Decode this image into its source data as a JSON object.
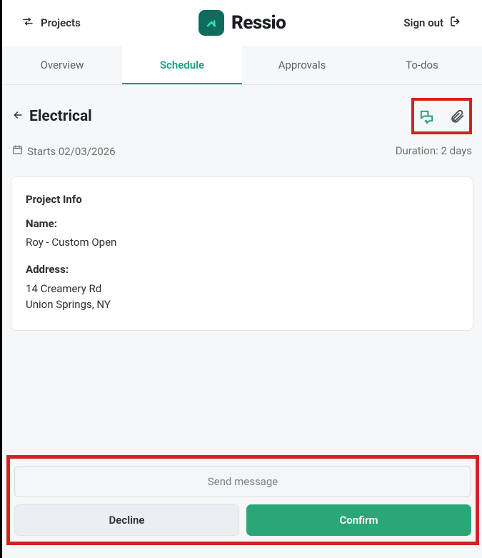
{
  "topbar": {
    "projects_label": "Projects",
    "brand_name": "Ressio",
    "signout_label": "Sign out"
  },
  "tabs": [
    {
      "label": "Overview",
      "active": false
    },
    {
      "label": "Schedule",
      "active": true
    },
    {
      "label": "Approvals",
      "active": false
    },
    {
      "label": "To-dos",
      "active": false
    }
  ],
  "page": {
    "title": "Electrical",
    "starts_text": "Starts 02/03/2026",
    "duration_text": "Duration: 2 days"
  },
  "project_info": {
    "heading": "Project Info",
    "name_label": "Name:",
    "name_value": "Roy - Custom Open",
    "address_label": "Address:",
    "address_line1": "14 Creamery Rd",
    "address_line2": "Union Springs, NY"
  },
  "footer": {
    "send_message_label": "Send message",
    "decline_label": "Decline",
    "confirm_label": "Confirm"
  },
  "colors": {
    "accent": "#1a9e7f",
    "highlight_border": "#d22222",
    "confirm_button": "#2aa777"
  }
}
